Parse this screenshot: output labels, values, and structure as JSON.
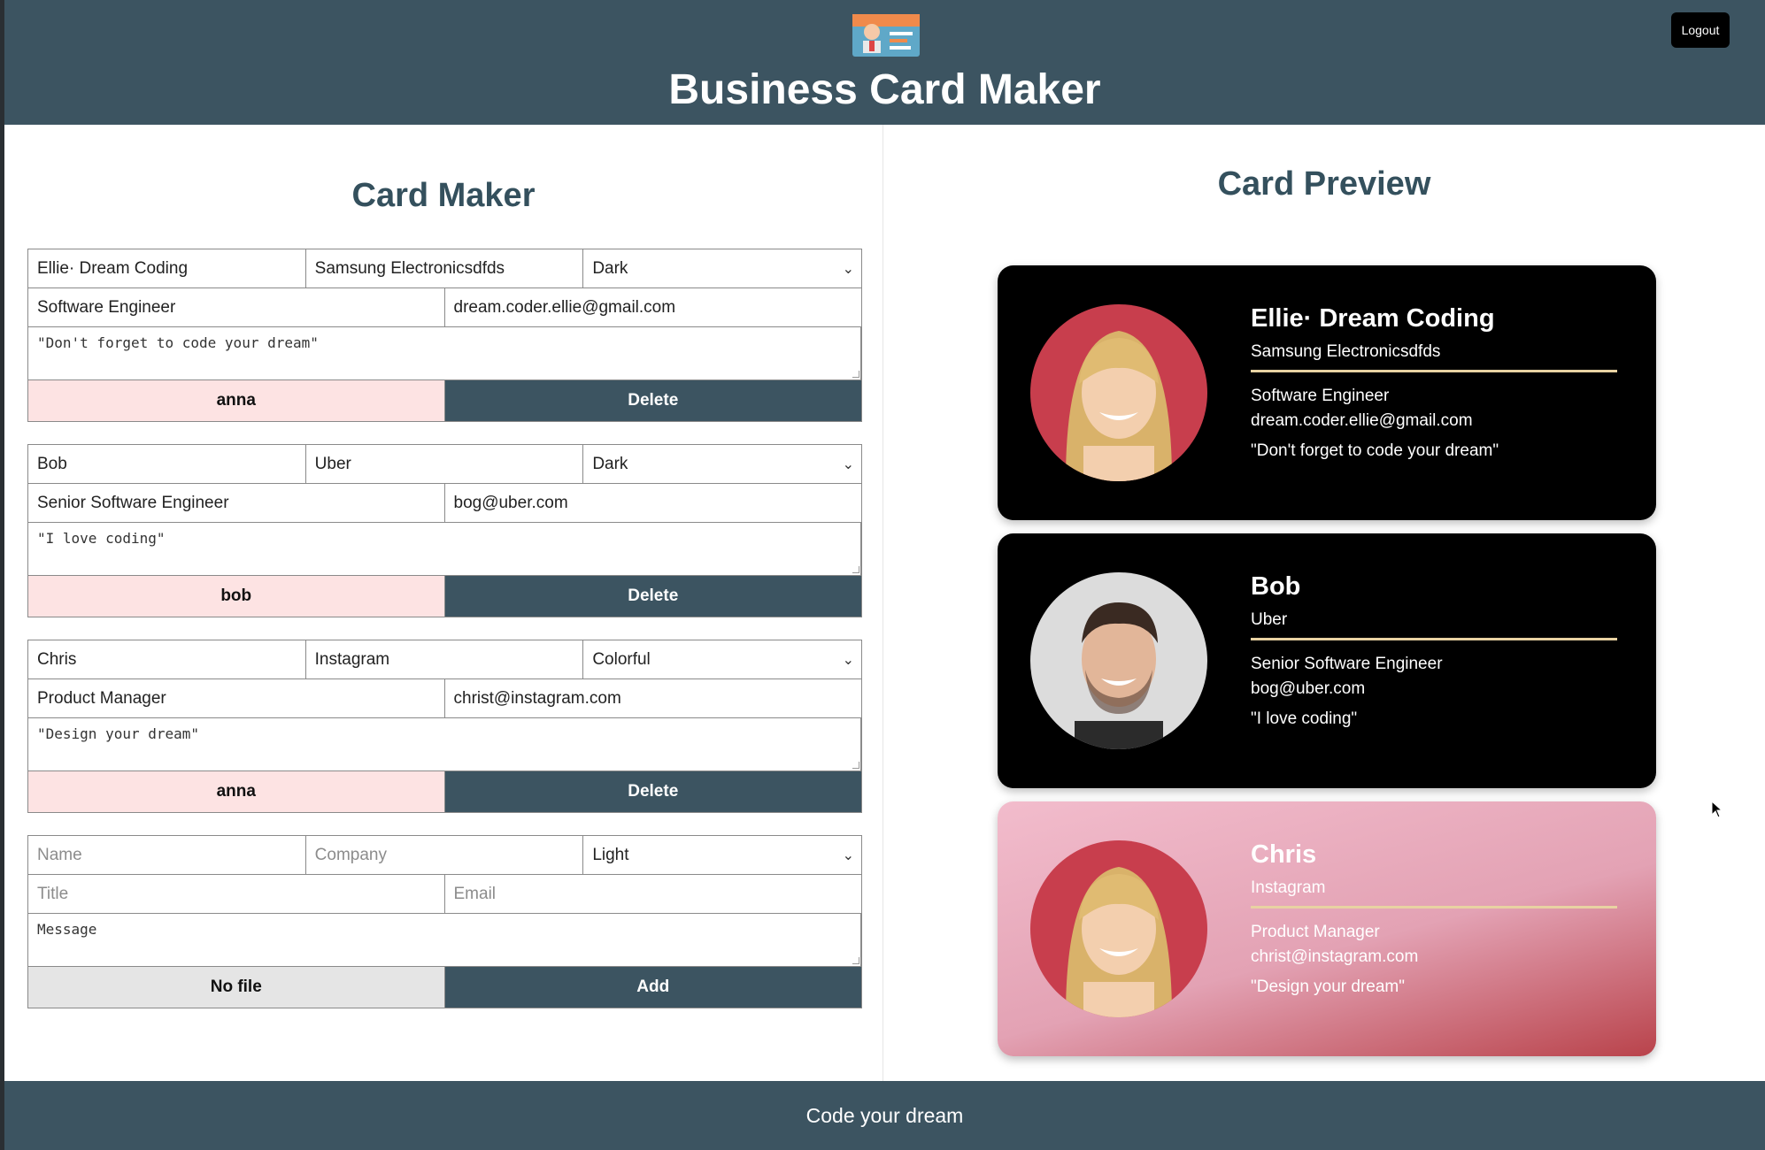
{
  "header": {
    "title": "Business Card Maker",
    "logout_label": "Logout"
  },
  "maker": {
    "title": "Card Maker",
    "cards": [
      {
        "name": "Ellie· Dream Coding",
        "company": "Samsung Electronicsdfds",
        "theme": "Dark",
        "title": "Software Engineer",
        "email": "dream.coder.ellie@gmail.com",
        "message": "\"Don't forget to code your dream\"",
        "file": "anna",
        "action": "Delete"
      },
      {
        "name": "Bob",
        "company": "Uber",
        "theme": "Dark",
        "title": "Senior Software Engineer",
        "email": "bog@uber.com",
        "message": "\"I love coding\"",
        "file": "bob",
        "action": "Delete"
      },
      {
        "name": "Chris",
        "company": "Instagram",
        "theme": "Colorful",
        "title": "Product Manager",
        "email": "christ@instagram.com",
        "message": "\"Design your dream\"",
        "file": "anna",
        "action": "Delete"
      }
    ],
    "add_form": {
      "name_placeholder": "Name",
      "company_placeholder": "Company",
      "theme": "Light",
      "title_placeholder": "Title",
      "email_placeholder": "Email",
      "message_placeholder": "Message",
      "file": "No file",
      "action": "Add"
    }
  },
  "preview": {
    "title": "Card Preview",
    "cards": [
      {
        "name": "Ellie· Dream Coding",
        "company": "Samsung Electronicsdfds",
        "title": "Software Engineer",
        "email": "dream.coder.ellie@gmail.com",
        "message": "\"Don't forget to code your dream\"",
        "theme": "dark"
      },
      {
        "name": "Bob",
        "company": "Uber",
        "title": "Senior Software Engineer",
        "email": "bog@uber.com",
        "message": "\"I love coding\"",
        "theme": "dark"
      },
      {
        "name": "Chris",
        "company": "Instagram",
        "title": "Product Manager",
        "email": "christ@instagram.com",
        "message": "\"Design your dream\"",
        "theme": "colorful"
      }
    ]
  },
  "footer": {
    "text": "Code your dream"
  },
  "colors": {
    "header_bg": "#3c5461",
    "file_button_bg": "#fde3e3",
    "accent_line": "#e8d2a2"
  }
}
